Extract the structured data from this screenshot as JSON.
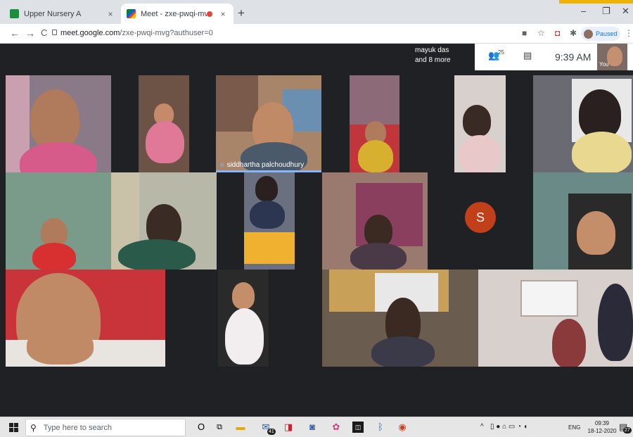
{
  "browser": {
    "tabs": [
      {
        "title": "Upper Nursery A",
        "close": "×"
      },
      {
        "title": "Meet - zxe-pwqi-mvg",
        "close": "×"
      }
    ],
    "new_tab": "+",
    "window_controls": {
      "minimize": "–",
      "maximize": "❐",
      "close": "✕"
    },
    "nav": {
      "back": "←",
      "forward": "→",
      "reload": "C"
    },
    "url_host": "meet.google.com",
    "url_path": "/zxe-pwqi-mvg?authuser=0",
    "profile_status": "Paused",
    "menu": "⋮"
  },
  "meet": {
    "overlay_name_line1": "mayuk das",
    "overlay_name_line2": "and 8 more",
    "participant_count": "25",
    "time": "9:39 AM",
    "self_label": "You",
    "speaker_name": "siddhartha palchoudhury",
    "avatar_letter": "S"
  },
  "taskbar": {
    "search_placeholder": "Type here to search",
    "mail_badge": "41",
    "language": "ENG",
    "clock_time": "09:39",
    "clock_date": "18-12-2020",
    "notification_count": "27"
  },
  "colors": {
    "meet_bg": "#202124",
    "accent": "#8ab4f8",
    "avatar": "#c1401a"
  }
}
